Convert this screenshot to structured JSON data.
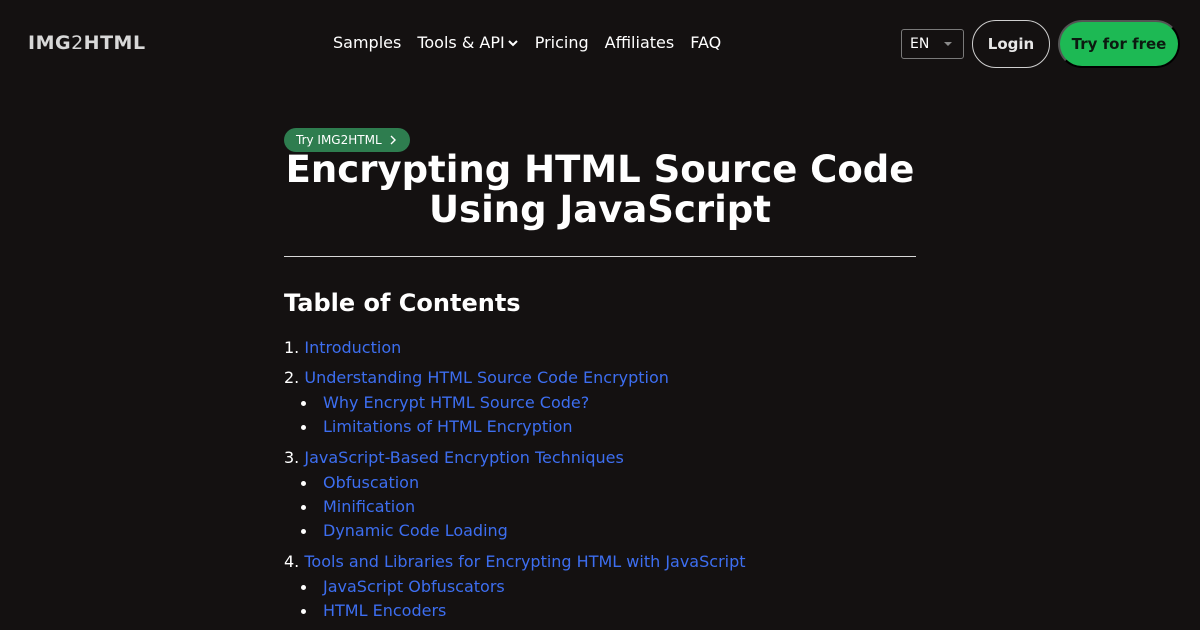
{
  "header": {
    "logo_prefix": "IMG",
    "logo_two": "2",
    "logo_suffix": "HTML",
    "nav": [
      {
        "label": "Samples"
      },
      {
        "label": "Tools & API"
      },
      {
        "label": "Pricing"
      },
      {
        "label": "Affiliates"
      },
      {
        "label": "FAQ"
      }
    ],
    "language": "EN",
    "login_label": "Login",
    "try_label": "Try for free"
  },
  "main": {
    "badge": "Try IMG2HTML",
    "title": "Encrypting HTML Source Code Using JavaScript",
    "toc_heading": "Table of Contents",
    "toc": [
      {
        "num": "1.",
        "label": "Introduction",
        "children": []
      },
      {
        "num": "2.",
        "label": "Understanding HTML Source Code Encryption",
        "children": [
          "Why Encrypt HTML Source Code?",
          "Limitations of HTML Encryption"
        ]
      },
      {
        "num": "3.",
        "label": "JavaScript-Based Encryption Techniques",
        "children": [
          "Obfuscation",
          "Minification",
          "Dynamic Code Loading"
        ]
      },
      {
        "num": "4.",
        "label": "Tools and Libraries for Encrypting HTML with JavaScript",
        "children": [
          "JavaScript Obfuscators",
          "HTML Encoders"
        ]
      }
    ]
  },
  "colors": {
    "background": "#141111",
    "accent_green": "#1db954",
    "badge_green": "#2e7d4f",
    "link_blue": "#3d6ef0"
  }
}
